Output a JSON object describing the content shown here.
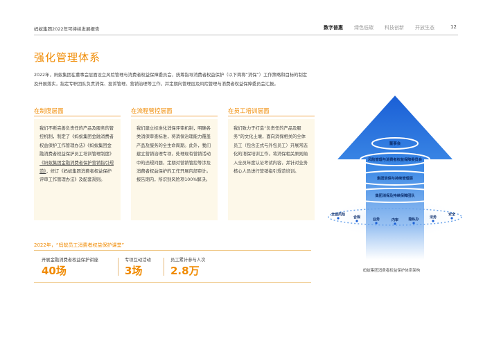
{
  "header": {
    "report_title": "蚂蚁集团2022年可持续发展报告",
    "nav": [
      "数字普惠",
      "绿色低碳",
      "科技创新",
      "开放生态"
    ],
    "active_index": 0,
    "page_number": "12"
  },
  "section": {
    "title": "强化管理体系",
    "intro": "2022年，蚂蚁集团在董事会层面设立风险管理与消费者权益保障委员会，统筹指导消费者权益保护（以下简称“消保”）工作策略和目标的制定及开展落实，指定专职团队负责消保、投诉管理、营销治理等工作，并定期向管理层及风险管理与消费者权益保障委员会汇报。"
  },
  "columns": [
    {
      "title": "在制度层面",
      "text_a": "我们不断完善负责任的产品及服务的管控机制，制定了《蚂蚁集团金融消费者权益保护工作管理办法》《蚂蚁集团金融消费者权益保护员工培训管理制度》",
      "text_link": "《蚂蚁集团金融消费者保护营销指引规范》",
      "text_b": "，修订《蚂蚁集团消费者权益保护评审工作管理办法》及配套规则。"
    },
    {
      "title": "在流程管控层面",
      "text": "我们建立标准化消保评审机制，明确各类消保审查标准，将消保治理能力覆盖产品及服务的全生命周期。此外，我们建立营销治理专项，处理现有营销活动中的违规问题，定期对营销管控等涉及消费者权益保护的工作开展内部审计。报告期内，所识别风险项100%解决。"
    },
    {
      "title": "在员工培训层面",
      "text": "我们致力于打造“负责任的产品及服务”的文化土壤，面向消保相关的全体员工（包含正式与外包员工）开展常态化的消保培训工作，将消保相关原则纳入全员年度认证考试内容，并针对业务核心人员进行营销指引规范培训。"
    }
  ],
  "stats": {
    "title": "2022年，“蚂蚁员工消费者权益保护课堂”",
    "items": [
      {
        "label": "开展金融消费者权益保护讲座",
        "value": "40场"
      },
      {
        "label": "专项互动活动",
        "value": "3场"
      },
      {
        "label": "员工累计参与人次",
        "value": "2.8万"
      }
    ]
  },
  "diagram": {
    "layers": [
      "董事会",
      "风险管理与消费者权益保障委员会",
      "集团消保与持续管理层",
      "集团消保及持续保障团队"
    ],
    "labels": [
      "全面风险",
      "合规",
      "业务",
      "内审",
      "隐私办",
      "法务",
      "安全"
    ],
    "caption": "蚂蚁集团消费者权益保护体系架构",
    "colors": {
      "accent": "#f08a00",
      "arrow_top": "#1a5fd6",
      "arrow_bottom": "#e8f1fc",
      "ring": "#ffffff"
    }
  }
}
